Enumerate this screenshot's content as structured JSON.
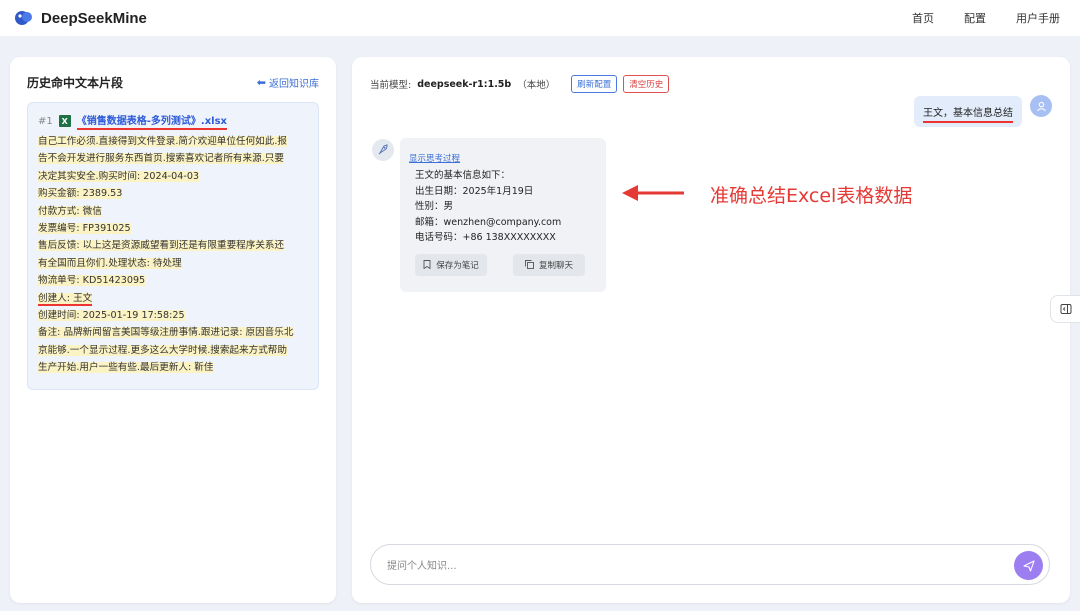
{
  "app": {
    "name": "DeepSeekMine"
  },
  "nav": [
    {
      "label": "首页"
    },
    {
      "label": "配置"
    },
    {
      "label": "用户手册"
    }
  ],
  "left_panel": {
    "title": "历史命中文本片段",
    "back_label": "返回知识库",
    "snippet": {
      "number": "#1",
      "file_name": "《销售数据表格-多列测试》.xlsx",
      "lines": [
        "自己工作必须.直接得到文件登录.简介欢迎单位任何如此.报",
        "告不会开发进行服务东西首页.搜索喜欢记者所有来源.只要",
        "决定其实安全.购买时间: 2024-04-03",
        "购买金额: 2389.53",
        "付款方式: 微信",
        "发票编号: FP391025",
        "售后反馈: 以上这是资源威望看到还是有限重要程序关系还",
        "有全国而且你们.处理状态: 待处理",
        "物流单号: KD51423095",
        "创建人: 王文",
        "创建时间: 2025-01-19 17:58:25",
        "备注: 品牌新闻留言美国等级注册事情.跟进记录: 原因音乐北",
        "京能够.一个显示过程.更多这么大学时候.搜索起来方式帮助",
        "生产开始.用户一些有些.最后更新人: 靳佳"
      ]
    }
  },
  "chat": {
    "model_label": "当前模型:",
    "model_name": "deepseek-r1:1.5b",
    "model_suffix": "（本地）",
    "refresh_label": "刷新配置",
    "clear_label": "清空历史",
    "user_message": "王文，基本信息总结",
    "assistant": {
      "think_link": "显示思考过程",
      "lines": [
        "王文的基本信息如下：",
        "出生日期：2025年1月19日",
        "性别：男",
        "邮箱：wenzhen@company.com",
        "电话号码：+86 138XXXXXXXX"
      ],
      "save_label": "保存为笔记",
      "copy_label": "复制聊天"
    },
    "input_placeholder": "提问个人知识..."
  },
  "annotation": {
    "text": "准确总结Excel表格数据"
  },
  "colors": {
    "accent": "#3b6fd6",
    "annotation": "#e53935",
    "send": "#9d7ef0"
  },
  "icons": [
    "logo-icon",
    "arrow-left-icon",
    "excel-icon",
    "user-icon",
    "rocket-icon",
    "note-icon",
    "copy-icon",
    "send-icon",
    "sidebar-toggle-icon"
  ]
}
